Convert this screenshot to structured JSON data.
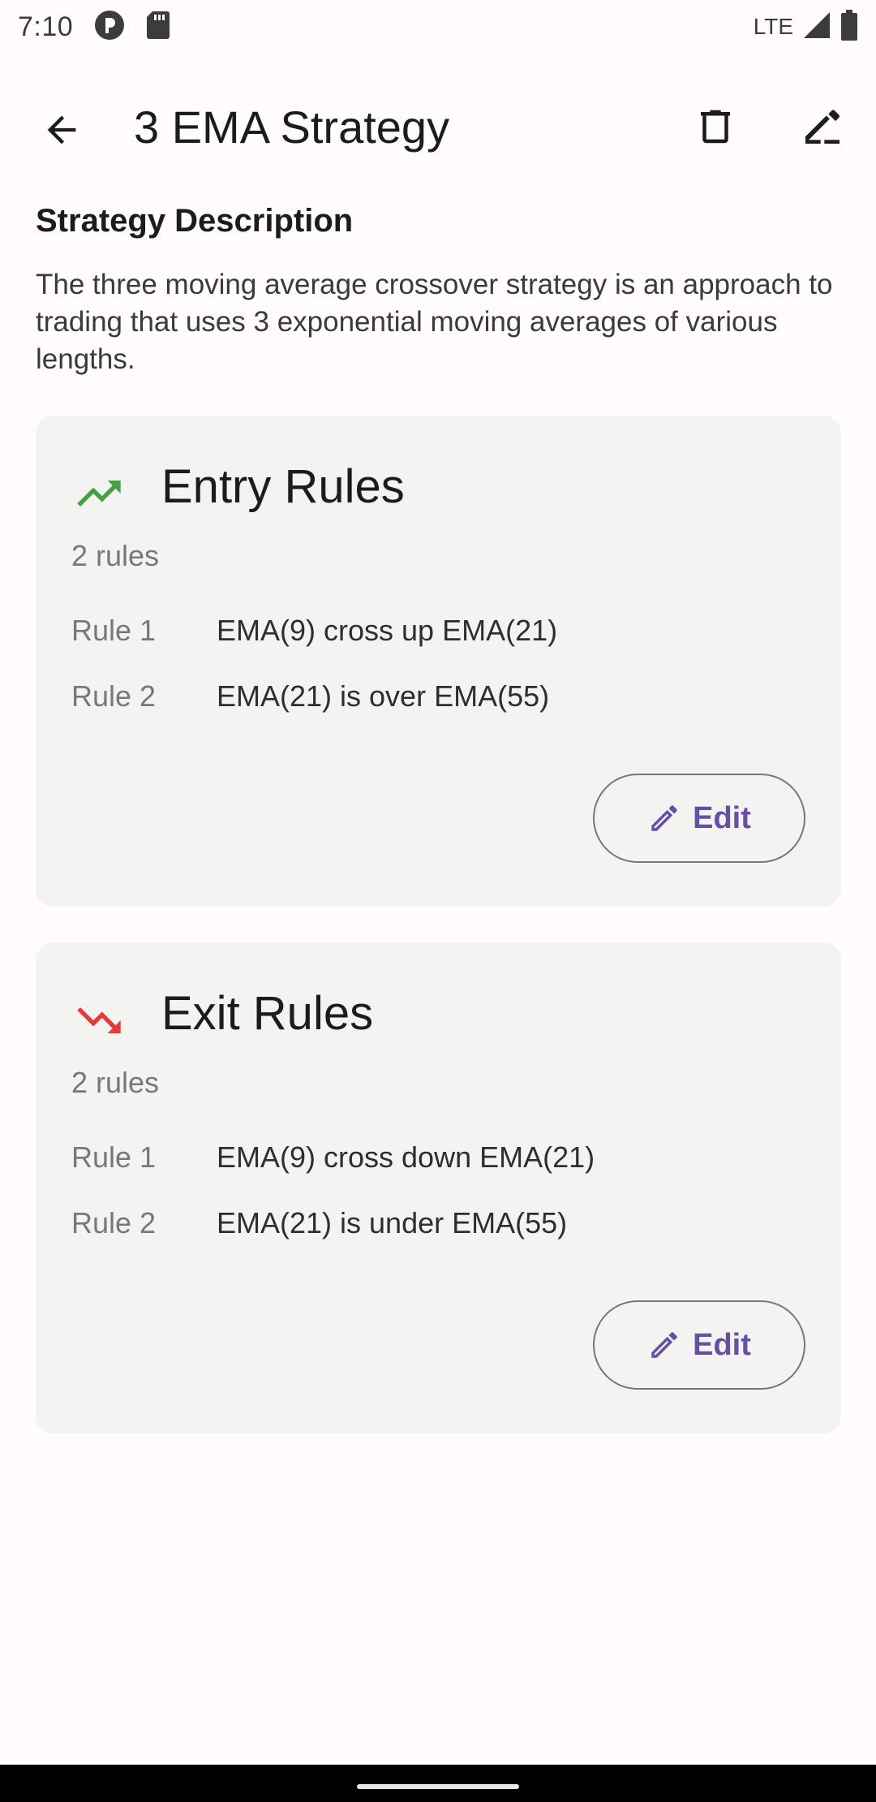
{
  "status_bar": {
    "time": "7:10",
    "network": "LTE",
    "icons": [
      "notification-icon",
      "sd-card-icon",
      "signal-icon",
      "battery-icon"
    ]
  },
  "app_bar": {
    "title": "3 EMA Strategy",
    "back_icon": "arrow-back-icon",
    "delete_icon": "trash-icon",
    "edit_icon": "edit-note-icon"
  },
  "description": {
    "heading": "Strategy Description",
    "text": "The three moving average crossover strategy is an approach to trading that uses 3 exponential moving averages of various lengths."
  },
  "entry_card": {
    "title": "Entry Rules",
    "icon": "trending-up-icon",
    "icon_color": "#43a047",
    "count": "2 rules",
    "rules": [
      {
        "label": "Rule 1",
        "text": "EMA(9) cross up EMA(21)"
      },
      {
        "label": "Rule 2",
        "text": "EMA(21) is over EMA(55)"
      }
    ],
    "edit_label": "Edit"
  },
  "exit_card": {
    "title": "Exit Rules",
    "icon": "trending-down-icon",
    "icon_color": "#e53935",
    "count": "2 rules",
    "rules": [
      {
        "label": "Rule 1",
        "text": "EMA(9) cross down EMA(21)"
      },
      {
        "label": "Rule 2",
        "text": "EMA(21) is under EMA(55)"
      }
    ],
    "edit_label": "Edit"
  },
  "colors": {
    "accent": "#6750a4",
    "background": "#fffbfe",
    "card": "#f3f4f2"
  }
}
